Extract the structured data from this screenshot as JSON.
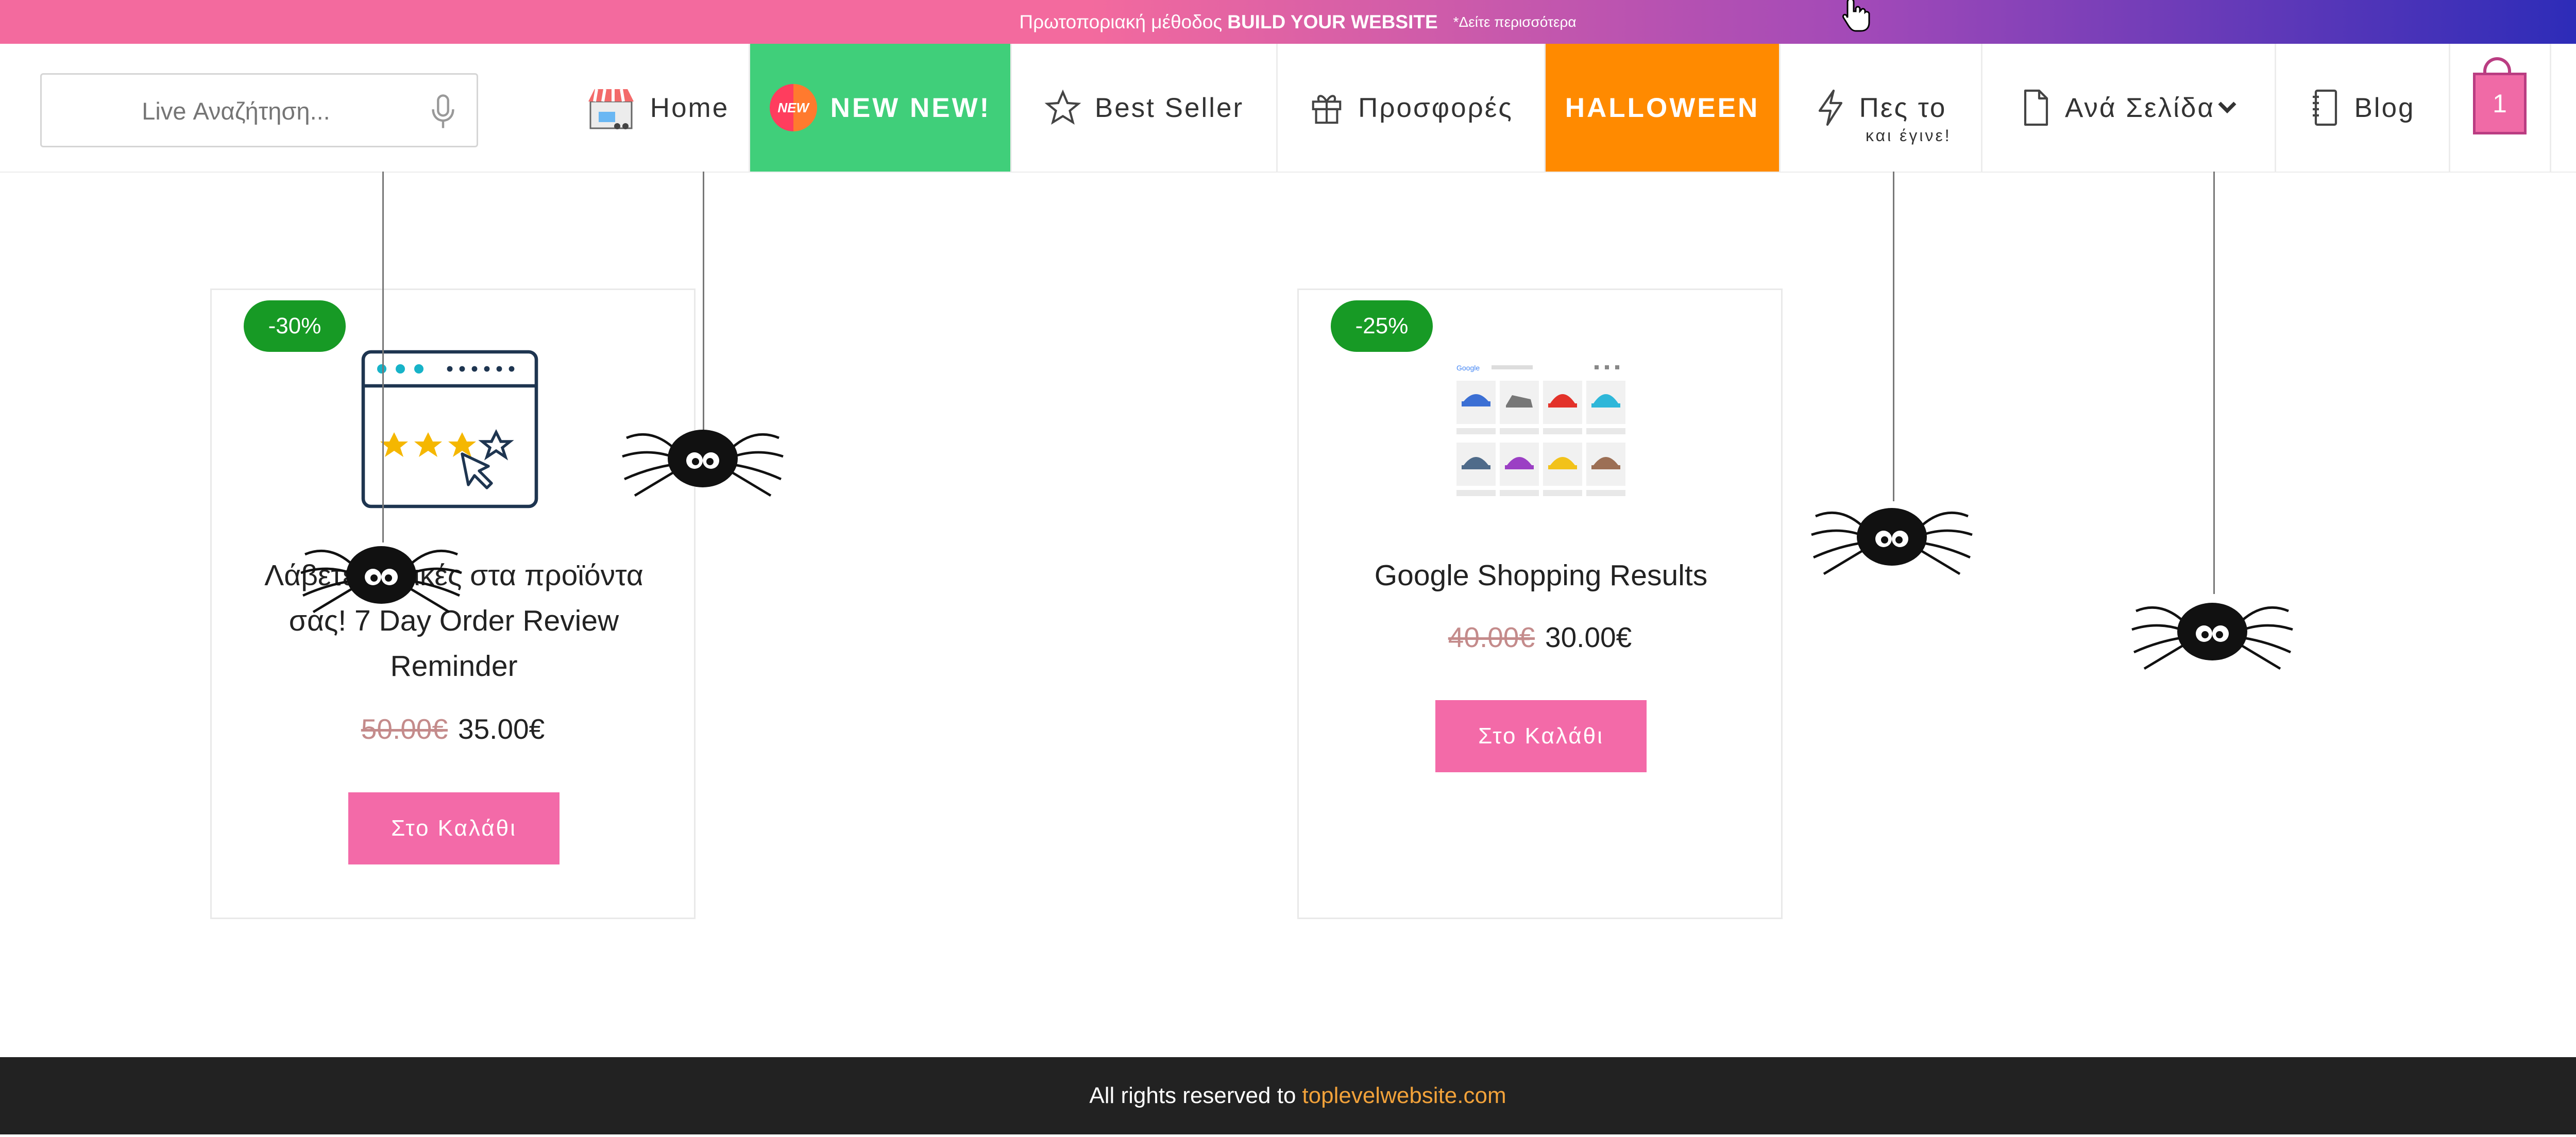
{
  "promo": {
    "text": "Πρωτοποριακή μέθοδος",
    "bold": "BUILD YOUR WEBSITE",
    "more": "*Δείτε περισσότερα"
  },
  "search": {
    "placeholder": "Live Αναζήτηση..."
  },
  "nav": {
    "home": "Home",
    "new_badge": "NEW",
    "new_label": "NEW NEW!",
    "best_seller": "Best Seller",
    "offers": "Προσφορές",
    "halloween": "HALLOWEEN",
    "pes_to": "Πες το",
    "pes_to_sub": "και έγινε!",
    "ana_selida": "Ανά Σελίδα",
    "blog": "Blog",
    "cart_count": "1"
  },
  "products": [
    {
      "discount": "-30%",
      "title": "Λάβετε κριτικές στα προϊόντα σας! 7 Day Order Review Reminder",
      "old_price": "50.00€",
      "price": "35.00€",
      "button": "Στο Καλάθι"
    },
    {
      "discount": "-25%",
      "title": "Google Shopping Results",
      "old_price": "40.00€",
      "price": "30.00€",
      "button": "Στο Καλάθι"
    }
  ],
  "footer": {
    "text": "All rights reserved to",
    "link": "toplevelwebsite.com"
  },
  "colors": {
    "accent_pink": "#f36aa8",
    "new_green": "#40cf7a",
    "halloween_orange": "#ff8a00",
    "discount_green": "#179a25",
    "footer_link": "#f2a23a"
  }
}
